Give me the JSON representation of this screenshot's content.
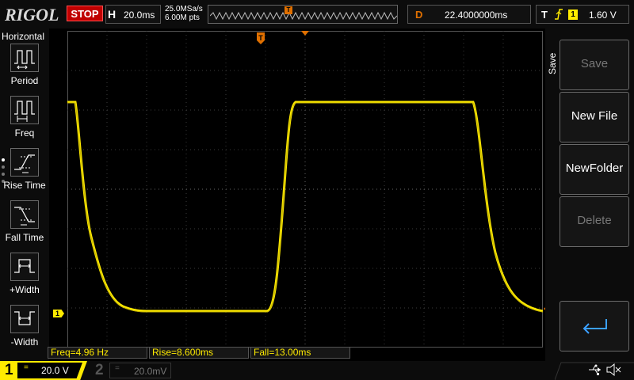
{
  "topbar": {
    "logo": "RIGOL",
    "run_state": "STOP",
    "horizontal_label": "H",
    "timebase": "20.0ms",
    "sample_rate": "25.0MSa/s",
    "memory_depth": "6.00M pts",
    "trigger_marker": "T",
    "delay_label": "D",
    "delay_value": "22.4000000ms",
    "trigger_label": "T",
    "trigger_edge_icon": "rising-edge-icon",
    "trigger_source": "1",
    "trigger_level": "1.60 V"
  },
  "left_menu": {
    "title": "Horizontal",
    "items": [
      {
        "label": "Period",
        "icon": "period-icon"
      },
      {
        "label": "Freq",
        "icon": "frequency-icon"
      },
      {
        "label": "Rise Time",
        "icon": "rise-time-icon"
      },
      {
        "label": "Fall Time",
        "icon": "fall-time-icon"
      },
      {
        "label": "+Width",
        "icon": "positive-width-icon"
      },
      {
        "label": "-Width",
        "icon": "negative-width-icon"
      }
    ]
  },
  "right_menu": {
    "title": "Save",
    "buttons": [
      {
        "label": "Save",
        "enabled": false
      },
      {
        "label": "New File",
        "enabled": true
      },
      {
        "label": "NewFolder",
        "enabled": true
      },
      {
        "label": "Delete",
        "enabled": false
      },
      {
        "label": "",
        "icon": "return-arrow-icon",
        "enabled": true
      }
    ]
  },
  "screen": {
    "top_trigger_marker": "T",
    "ch1_ground_marker": "1"
  },
  "measurements": {
    "freq": "Freq=4.96 Hz",
    "rise": "Rise=8.600ms",
    "fall": "Fall=13.00ms"
  },
  "channels": {
    "ch1": {
      "number": "1",
      "coupling": "=",
      "scale": "20.0 V"
    },
    "ch2": {
      "number": "2",
      "coupling": "=",
      "scale": "20.0mV"
    }
  },
  "status": {
    "usb_icon": "usb-icon",
    "speaker_icon": "speaker-muted-icon"
  },
  "colors": {
    "ch1": "#ffeb00",
    "trigger": "#e07000",
    "stop": "#c00000"
  }
}
